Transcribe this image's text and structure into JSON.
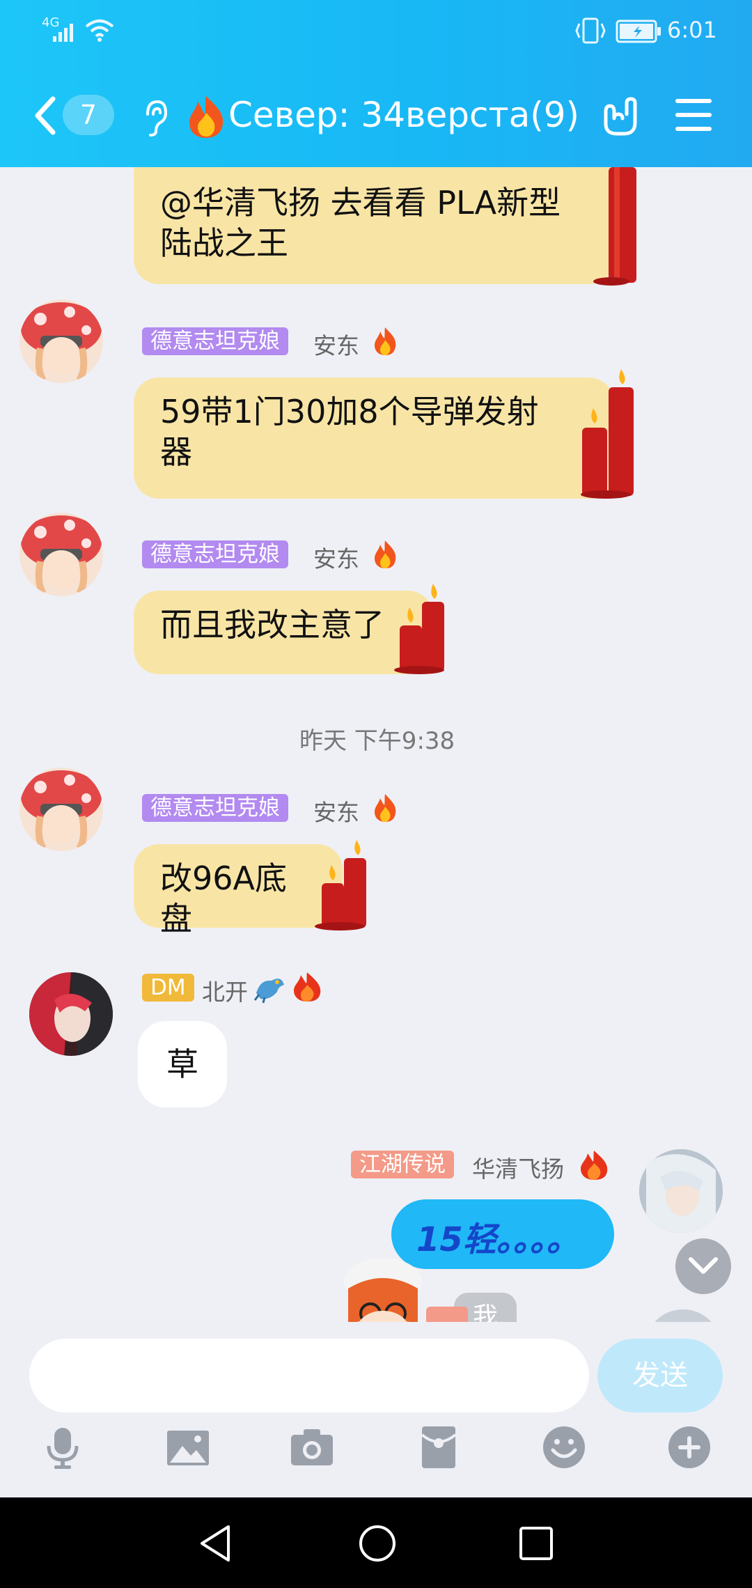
{
  "status_bar": {
    "network": "4G",
    "time": "6:01"
  },
  "header": {
    "unread_count": "7",
    "title": "Север: 34верста(9)"
  },
  "messages": [
    {
      "tag": "",
      "name": "",
      "text": "@华清飞扬 去看看 PLA新型\n陆战之王"
    },
    {
      "tag": "德意志坦克娘",
      "name": "安东",
      "text": "59带1门30加8个导弹发射\n器"
    },
    {
      "tag": "德意志坦克娘",
      "name": "安东",
      "text": "而且我改主意了"
    },
    {
      "tag": "德意志坦克娘",
      "name": "安东",
      "text": "改96A底盘"
    },
    {
      "tag": "DM",
      "name": "北开",
      "text": "草"
    },
    {
      "tag": "江湖传说",
      "name": "华清飞扬",
      "text": "15轻。。。。"
    }
  ],
  "time_label": "昨天 下午9:38",
  "partial_bubble": "我",
  "input": {
    "placeholder": "",
    "send_label": "发送"
  },
  "colors": {
    "accent": "#1dc6f8",
    "tag_purple": "#b28af0",
    "tag_gold": "#f0b93a",
    "tag_salmon": "#f49a88",
    "bubble_yellow": "#f8e5a6",
    "bubble_blue": "#20b8f7"
  },
  "icons": [
    "back-chevron-icon",
    "ear-icon",
    "fire-icon",
    "hand-gesture-icon",
    "menu-icon",
    "microphone-icon",
    "image-icon",
    "camera-icon",
    "red-packet-icon",
    "emoji-icon",
    "plus-icon",
    "chevron-down-icon",
    "nav-back-icon",
    "nav-home-icon",
    "nav-recents-icon"
  ]
}
